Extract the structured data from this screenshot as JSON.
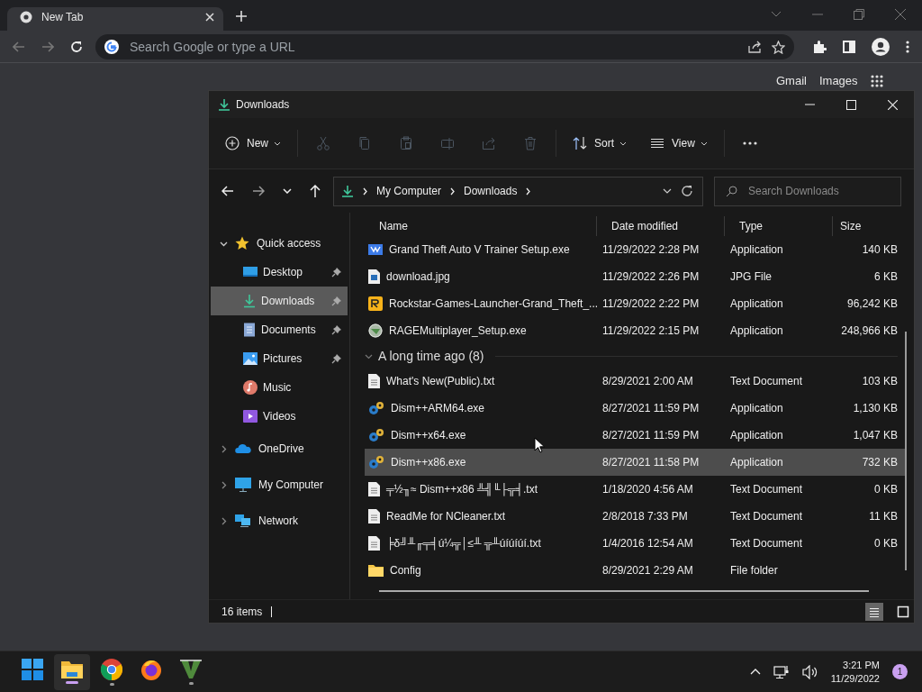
{
  "browser": {
    "tab": {
      "title": "New Tab",
      "selected": true
    },
    "address": {
      "placeholder": "Search Google or type a URL"
    },
    "top_links": [
      "Gmail",
      "Images"
    ]
  },
  "explorer": {
    "title": "Downloads",
    "commands": [
      {
        "kind": "new",
        "label": "New",
        "disabled": false
      },
      {
        "kind": "cut",
        "disabled": true
      },
      {
        "kind": "copy",
        "disabled": true
      },
      {
        "kind": "paste",
        "disabled": true
      },
      {
        "kind": "rename",
        "disabled": true
      },
      {
        "kind": "share",
        "disabled": true
      },
      {
        "kind": "delete",
        "disabled": true
      },
      {
        "kind": "sort",
        "label": "Sort",
        "disabled": false
      },
      {
        "kind": "view",
        "label": "View",
        "disabled": false
      },
      {
        "kind": "more",
        "disabled": false
      }
    ],
    "breadcrumb": [
      "My Computer",
      "Downloads"
    ],
    "search": {
      "placeholder": "Search Downloads"
    },
    "nav": [
      {
        "label": "Quick access",
        "kind": "star",
        "expanded": true,
        "selected": false,
        "children": [
          {
            "label": "Desktop",
            "kind": "desktop",
            "pinned": true,
            "selected": false
          },
          {
            "label": "Downloads",
            "kind": "download",
            "pinned": true,
            "selected": true
          },
          {
            "label": "Documents",
            "kind": "documents",
            "pinned": true,
            "selected": false
          },
          {
            "label": "Pictures",
            "kind": "pictures",
            "pinned": true,
            "selected": false
          },
          {
            "label": "Music",
            "kind": "music",
            "pinned": false,
            "selected": false
          },
          {
            "label": "Videos",
            "kind": "videos",
            "pinned": false,
            "selected": false
          }
        ]
      },
      {
        "label": "OneDrive",
        "kind": "cloud",
        "expanded": false,
        "selected": false
      },
      {
        "label": "My Computer",
        "kind": "computer",
        "expanded": false,
        "selected": false
      },
      {
        "label": "Network",
        "kind": "network",
        "expanded": false,
        "selected": false
      }
    ],
    "columns": [
      "Name",
      "Date modified",
      "Type",
      "Size"
    ],
    "sections": [
      {
        "rows": [
          {
            "kind": "trainer",
            "name": "Grand Theft Auto V Trainer Setup.exe",
            "date": "11/29/2022 2:28 PM",
            "type": "Application",
            "size": "140 KB",
            "selected": false
          },
          {
            "kind": "image",
            "name": "download.jpg",
            "date": "11/29/2022 2:26 PM",
            "type": "JPG File",
            "size": "6 KB",
            "selected": false
          },
          {
            "kind": "rockstar",
            "name": "Rockstar-Games-Launcher-Grand_Theft_...",
            "date": "11/29/2022 2:22 PM",
            "type": "Application",
            "size": "96,242 KB",
            "selected": false
          },
          {
            "kind": "rage",
            "name": "RAGEMultiplayer_Setup.exe",
            "date": "11/29/2022 2:15 PM",
            "type": "Application",
            "size": "248,966 KB",
            "selected": false
          }
        ]
      },
      {
        "label": "A long time ago (8)",
        "expanded": true,
        "rows": [
          {
            "kind": "text",
            "name": "What's New(Public).txt",
            "date": "8/29/2021 2:00 AM",
            "type": "Text Document",
            "size": "103 KB",
            "selected": false
          },
          {
            "kind": "gear",
            "name": "Dism++ARM64.exe",
            "date": "8/27/2021 11:59 PM",
            "type": "Application",
            "size": "1,130 KB",
            "selected": false
          },
          {
            "kind": "gear",
            "name": "Dism++x64.exe",
            "date": "8/27/2021 11:59 PM",
            "type": "Application",
            "size": "1,047 KB",
            "selected": false
          },
          {
            "kind": "gear",
            "name": "Dism++x86.exe",
            "date": "8/27/2021 11:58 PM",
            "type": "Application",
            "size": "732 KB",
            "selected": true
          },
          {
            "kind": "text",
            "name": "╤½╖≈ Dism++x86 ╩╣╙├╦╡.txt",
            "date": "1/18/2020 4:56 AM",
            "type": "Text Document",
            "size": "0 KB",
            "selected": false
          },
          {
            "kind": "text",
            "name": "ReadMe for NCleaner.txt",
            "date": "2/8/2018 7:33 PM",
            "type": "Text Document",
            "size": "11 KB",
            "selected": false
          },
          {
            "kind": "text",
            "name": "╞δ╝╨╓╤╡ú¼╦│≤╨ ╦╨úíúíúí.txt",
            "date": "1/4/2016 12:54 AM",
            "type": "Text Document",
            "size": "0 KB",
            "selected": false
          },
          {
            "kind": "folder",
            "name": "Config",
            "date": "8/29/2021 2:29 AM",
            "type": "File folder",
            "size": "",
            "selected": false
          }
        ]
      }
    ],
    "status": "16 items",
    "views": [
      {
        "kind": "details",
        "selected": true
      },
      {
        "kind": "tiles",
        "selected": false
      }
    ]
  },
  "taskbar": {
    "apps": [
      {
        "kind": "start",
        "active": false,
        "running": false
      },
      {
        "kind": "files",
        "active": true,
        "running": true
      },
      {
        "kind": "chrome",
        "active": false,
        "running": true
      },
      {
        "kind": "firefox",
        "active": false,
        "running": false
      },
      {
        "kind": "v",
        "active": false,
        "running": true
      }
    ],
    "time": "3:21 PM",
    "date": "11/29/2022",
    "notifications": "1"
  }
}
